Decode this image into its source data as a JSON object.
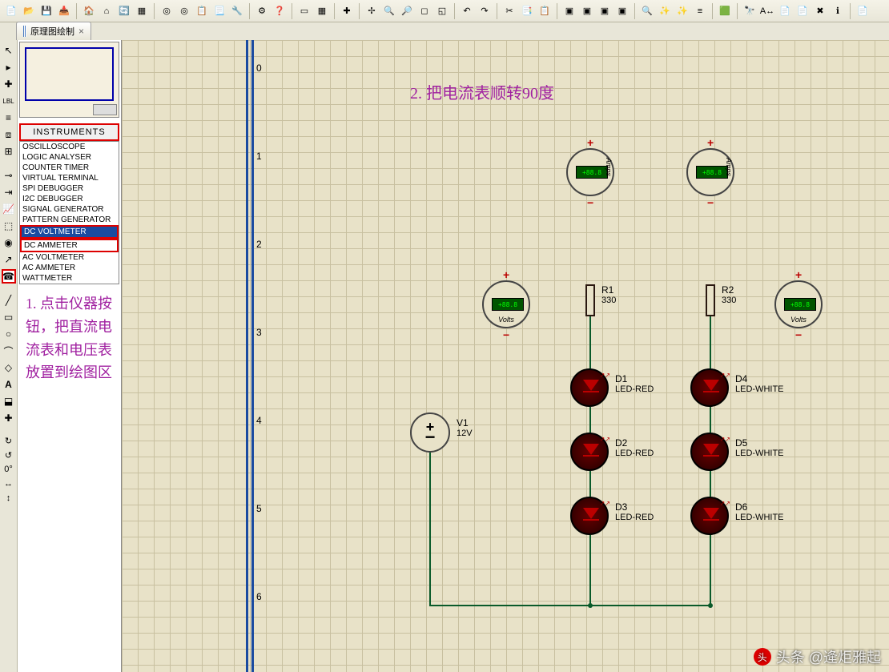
{
  "tab": {
    "title": "原理图绘制",
    "close": "×"
  },
  "sidebar": {
    "header": "INSTRUMENTS",
    "items": [
      "OSCILLOSCOPE",
      "LOGIC ANALYSER",
      "COUNTER TIMER",
      "VIRTUAL TERMINAL",
      "SPI DEBUGGER",
      "I2C DEBUGGER",
      "SIGNAL GENERATOR",
      "PATTERN GENERATOR",
      "DC VOLTMETER",
      "DC AMMETER",
      "AC VOLTMETER",
      "AC AMMETER",
      "WATTMETER"
    ]
  },
  "annotation1": "1. 点击仪器按钮，把直流电流表和电压表放置到绘图区",
  "annotation2": "2. 把电流表顺转90度",
  "ruler": [
    "0",
    "1",
    "2",
    "3",
    "4",
    "5",
    "6"
  ],
  "rotation": {
    "angle": "0°"
  },
  "meters": {
    "amps": "Amps",
    "volts": "Volts",
    "reading": "+88.8",
    "plus": "+",
    "minus": "−"
  },
  "components": {
    "r1": {
      "name": "R1",
      "value": "330"
    },
    "r2": {
      "name": "R2",
      "value": "330"
    },
    "v1": {
      "name": "V1",
      "value": "12V"
    },
    "d1": {
      "name": "D1",
      "value": "LED-RED"
    },
    "d2": {
      "name": "D2",
      "value": "LED-RED"
    },
    "d3": {
      "name": "D3",
      "value": "LED-RED"
    },
    "d4": {
      "name": "D4",
      "value": "LED-WHITE"
    },
    "d5": {
      "name": "D5",
      "value": "LED-WHITE"
    },
    "d6": {
      "name": "D6",
      "value": "LED-WHITE"
    }
  },
  "watermark": "头条 @逄炬雅起"
}
